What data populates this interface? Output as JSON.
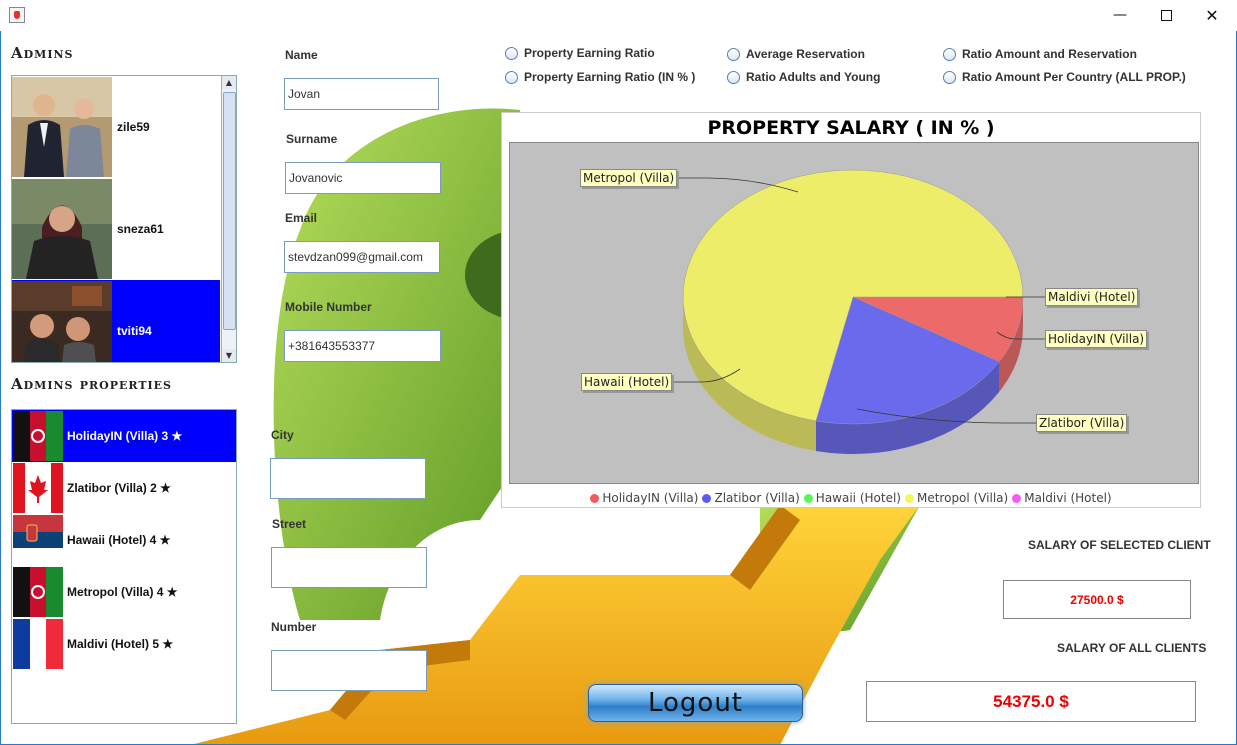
{
  "window": {
    "minimize": "—",
    "maximize": "",
    "close": "✕"
  },
  "admins": {
    "title": "Admins",
    "items": [
      {
        "name": "zile59",
        "selected": false
      },
      {
        "name": "sneza61",
        "selected": false
      },
      {
        "name": "tviti94",
        "selected": true
      }
    ]
  },
  "properties": {
    "title": "Admins properties",
    "items": [
      {
        "label": "HolidayIN (Villa) 3 ★",
        "flag": "flag-afghanistan-icon",
        "selected": true
      },
      {
        "label": "Zlatibor (Villa) 2 ★",
        "flag": "flag-canada-icon",
        "selected": false
      },
      {
        "label": "Hawaii (Hotel) 4 ★",
        "flag": "flag-serbia-icon",
        "selected": false
      },
      {
        "label": "Metropol (Villa) 4 ★",
        "flag": "flag-afghanistan-icon",
        "selected": false
      },
      {
        "label": "Maldivi (Hotel) 5 ★",
        "flag": "flag-france-icon",
        "selected": false
      }
    ]
  },
  "form": {
    "name_label": "Name",
    "name_value": "Jovan",
    "surname_label": "Surname",
    "surname_value": "Jovanovic",
    "email_label": "Email",
    "email_value": "stevdzan099@gmail.com",
    "mobile_label": "Mobile Number",
    "mobile_value": "+381643553377",
    "city_label": "City",
    "city_value": "",
    "street_label": "Street",
    "street_value": "",
    "number_label": "Number",
    "number_value": ""
  },
  "radios": {
    "property_earning_ratio": "Property Earning Ratio",
    "property_earning_ratio_pct": "Property Earning Ratio (IN % )",
    "average_reservation": "Average Reservation",
    "ratio_adults_young": "Ratio Adults and Young",
    "ratio_amount_reservation": "Ratio Amount and  Reservation",
    "ratio_amount_country": "Ratio Amount Per Country (ALL PROP.)"
  },
  "chart_data": {
    "type": "pie",
    "title": "PROPERTY SALARY ( IN % )",
    "categories": [
      "HolidayIN (Villa)",
      "Zlatibor (Villa)",
      "Hawaii (Hotel)",
      "Metropol (Villa)",
      "Maldivi (Hotel)"
    ],
    "values": [
      8.5,
      20,
      0,
      71.5,
      0
    ],
    "colors": [
      "#f55a5a",
      "#5a5af5",
      "#5af55a",
      "#f5f55a",
      "#f55af5"
    ],
    "legend_position": "bottom",
    "plot_background": "#c0c0c0",
    "callouts": [
      "Metropol (Villa)",
      "Maldivi (Hotel)",
      "HolidayIN (Villa)",
      "Hawaii (Hotel)",
      "Zlatibor (Villa)"
    ]
  },
  "salary": {
    "selected_label": "SALARY OF SELECTED CLIENT",
    "selected_value": "27500.0 $",
    "all_label": "SALARY OF ALL CLIENTS",
    "all_value": "54375.0 $"
  },
  "logout_label": "Logout",
  "colors": {
    "selection": "#0000ff",
    "salary_text": "#e00000",
    "window_border": "#2b78c9"
  }
}
